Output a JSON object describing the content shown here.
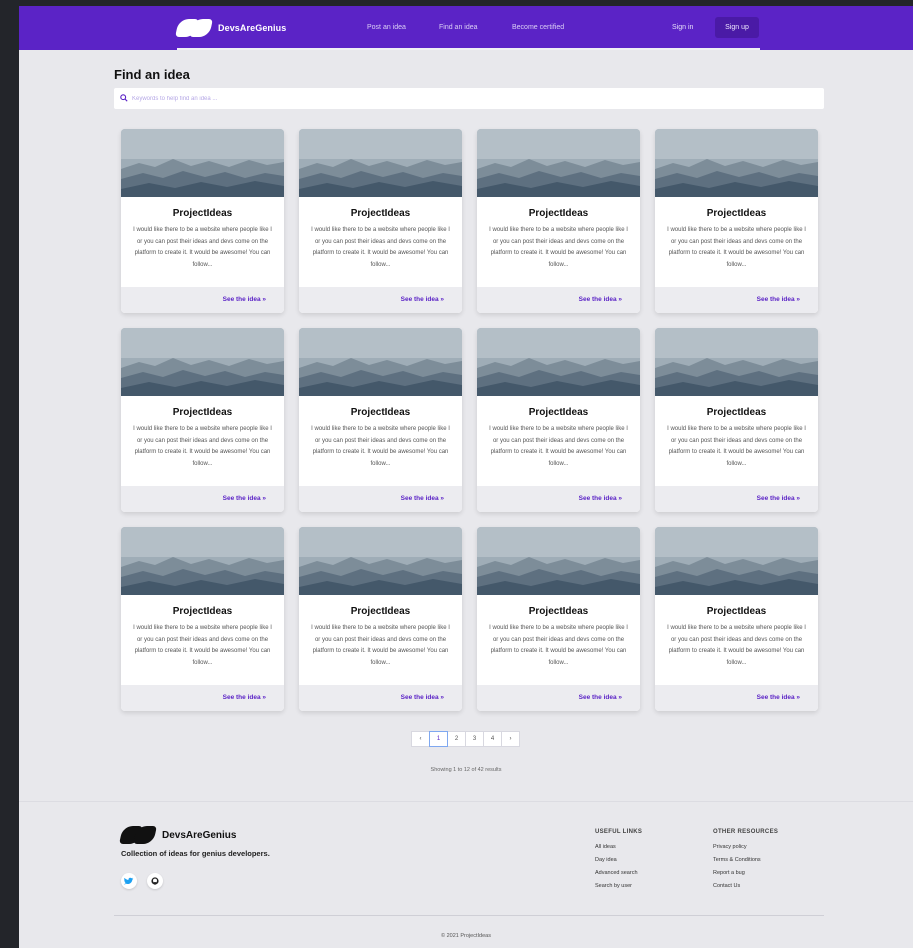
{
  "brand": {
    "name": "DevsAreGenius"
  },
  "nav": {
    "links": [
      "Post an idea",
      "Find an idea",
      "Become certified"
    ],
    "signin": "Sign in",
    "signup": "Sign up"
  },
  "page": {
    "title": "Find an idea",
    "search_placeholder": "Keywords to help find an idea ..."
  },
  "cards": [
    {
      "title": "ProjectIdeas",
      "description": "I would like there to be a website where people like I or you can post their ideas and devs come on the platform to create it. It would be awesome! You can follow...",
      "link": "See the idea »"
    },
    {
      "title": "ProjectIdeas",
      "description": "I would like there to be a website where people like I or you can post their ideas and devs come on the platform to create it. It would be awesome! You can follow...",
      "link": "See the idea »"
    },
    {
      "title": "ProjectIdeas",
      "description": "I would like there to be a website where people like I or you can post their ideas and devs come on the platform to create it. It would be awesome! You can follow...",
      "link": "See the idea »"
    },
    {
      "title": "ProjectIdeas",
      "description": "I would like there to be a website where people like I or you can post their ideas and devs come on the platform to create it. It would be awesome! You can follow...",
      "link": "See the idea »"
    },
    {
      "title": "ProjectIdeas",
      "description": "I would like there to be a website where people like I or you can post their ideas and devs come on the platform to create it. It would be awesome! You can follow...",
      "link": "See the idea »"
    },
    {
      "title": "ProjectIdeas",
      "description": "I would like there to be a website where people like I or you can post their ideas and devs come on the platform to create it. It would be awesome! You can follow...",
      "link": "See the idea »"
    },
    {
      "title": "ProjectIdeas",
      "description": "I would like there to be a website where people like I or you can post their ideas and devs come on the platform to create it. It would be awesome! You can follow...",
      "link": "See the idea »"
    },
    {
      "title": "ProjectIdeas",
      "description": "I would like there to be a website where people like I or you can post their ideas and devs come on the platform to create it. It would be awesome! You can follow...",
      "link": "See the idea »"
    },
    {
      "title": "ProjectIdeas",
      "description": "I would like there to be a website where people like I or you can post their ideas and devs come on the platform to create it. It would be awesome! You can follow...",
      "link": "See the idea »"
    },
    {
      "title": "ProjectIdeas",
      "description": "I would like there to be a website where people like I or you can post their ideas and devs come on the platform to create it. It would be awesome! You can follow...",
      "link": "See the idea »"
    },
    {
      "title": "ProjectIdeas",
      "description": "I would like there to be a website where people like I or you can post their ideas and devs come on the platform to create it. It would be awesome! You can follow...",
      "link": "See the idea »"
    },
    {
      "title": "ProjectIdeas",
      "description": "I would like there to be a website where people like I or you can post their ideas and devs come on the platform to create it. It would be awesome! You can follow...",
      "link": "See the idea »"
    }
  ],
  "pagination": {
    "prev": "‹",
    "pages": [
      "1",
      "2",
      "3",
      "4"
    ],
    "next": "›",
    "active": "1",
    "results_text": "Showing 1 to 12 of 42 results"
  },
  "footer": {
    "brand": "DevsAreGenius",
    "tagline": "Collection of ideas for genius developers.",
    "social": [
      "twitter-icon",
      "github-icon"
    ],
    "useful_links": {
      "heading": "USEFUL LINKS",
      "items": [
        "All ideas",
        "Day idea",
        "Advanced search",
        "Search by user"
      ]
    },
    "other_resources": {
      "heading": "OTHER RESOURCES",
      "items": [
        "Privacy policy",
        "Terms & Conditions",
        "Report a bug",
        "Contact Us"
      ]
    },
    "copyright": "© 2021 ProjectIdeas"
  },
  "colors": {
    "primary": "#5b23c6",
    "background": "#e8e8ec",
    "card": "#ffffff"
  }
}
